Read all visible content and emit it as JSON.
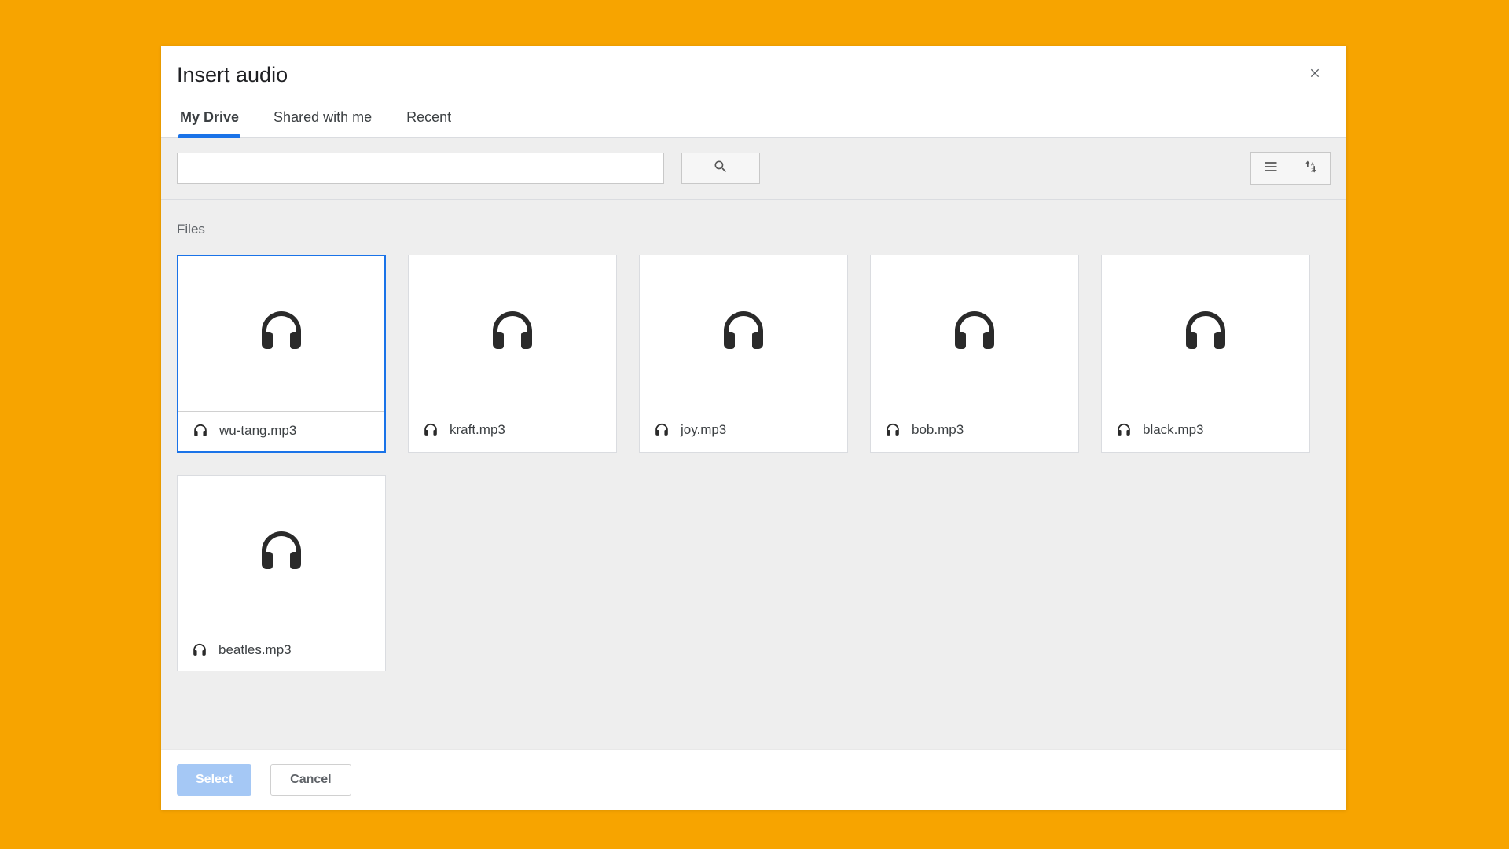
{
  "dialog": {
    "title": "Insert audio"
  },
  "tabs": [
    {
      "label": "My Drive",
      "active": true
    },
    {
      "label": "Shared with me",
      "active": false
    },
    {
      "label": "Recent",
      "active": false
    }
  ],
  "search": {
    "value": "",
    "placeholder": ""
  },
  "section_label": "Files",
  "files": [
    {
      "name": "wu-tang.mp3",
      "selected": true
    },
    {
      "name": "kraft.mp3",
      "selected": false
    },
    {
      "name": "joy.mp3",
      "selected": false
    },
    {
      "name": "bob.mp3",
      "selected": false
    },
    {
      "name": "black.mp3",
      "selected": false
    },
    {
      "name": "beatles.mp3",
      "selected": false
    }
  ],
  "footer": {
    "select_label": "Select",
    "cancel_label": "Cancel"
  },
  "colors": {
    "page_bg": "#f7a400",
    "accent": "#1a73e8",
    "primary_btn": "#a5c8f5"
  }
}
